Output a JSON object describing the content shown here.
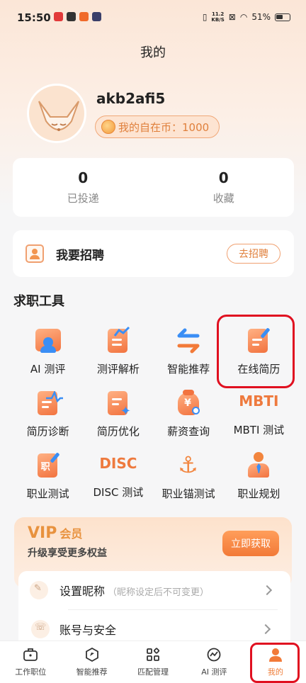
{
  "status": {
    "time": "15:50",
    "speed_top": "11.2",
    "speed_bottom": "KB/S",
    "battery": "51%"
  },
  "header": {
    "title": "我的"
  },
  "profile": {
    "username": "akb2afi5",
    "coin_text": "我的自在币：1000"
  },
  "stats": [
    {
      "value": "0",
      "label": "已投递"
    },
    {
      "value": "0",
      "label": "收藏"
    }
  ],
  "recruit": {
    "title": "我要招聘",
    "button": "去招聘"
  },
  "tools_section": {
    "title": "求职工具"
  },
  "tools": [
    {
      "label": "AI 测评",
      "icon": "ai-assessment-icon"
    },
    {
      "label": "测评解析",
      "icon": "assessment-analysis-icon"
    },
    {
      "label": "智能推荐",
      "icon": "smart-recommend-icon"
    },
    {
      "label": "在线简历",
      "icon": "online-resume-icon"
    },
    {
      "label": "简历诊断",
      "icon": "resume-diagnosis-icon"
    },
    {
      "label": "简历优化",
      "icon": "resume-optimize-icon"
    },
    {
      "label": "薪资查询",
      "icon": "salary-query-icon",
      "glyph": "¥"
    },
    {
      "label": "MBTI 测试",
      "icon": "mbti-icon",
      "glyph": "MBTI"
    },
    {
      "label": "职业测试",
      "icon": "career-test-icon",
      "glyph": "职"
    },
    {
      "label": "DISC 测试",
      "icon": "disc-icon",
      "glyph": "DISC"
    },
    {
      "label": "职业锚测试",
      "icon": "career-anchor-icon",
      "glyph": "⚓"
    },
    {
      "label": "职业规划",
      "icon": "career-plan-icon"
    }
  ],
  "vip": {
    "title": "VIP",
    "title_suffix": "会员",
    "subtitle": "升级享受更多权益",
    "button": "立即获取"
  },
  "settings": [
    {
      "label": "设置昵称",
      "hint": "（昵称设定后不可变更）",
      "icon": "edit-icon"
    },
    {
      "label": "账号与安全",
      "hint": "",
      "icon": "phone-icon"
    }
  ],
  "tabbar": [
    {
      "label": "工作职位",
      "icon": "briefcase-icon"
    },
    {
      "label": "智能推荐",
      "icon": "compass-icon"
    },
    {
      "label": "匹配管理",
      "icon": "grid-icon"
    },
    {
      "label": "AI 测评",
      "icon": "chart-icon"
    },
    {
      "label": "我的",
      "icon": "user-icon",
      "active": true
    }
  ],
  "colors": {
    "accent": "#ef7f3c",
    "highlight": "#e01020"
  }
}
